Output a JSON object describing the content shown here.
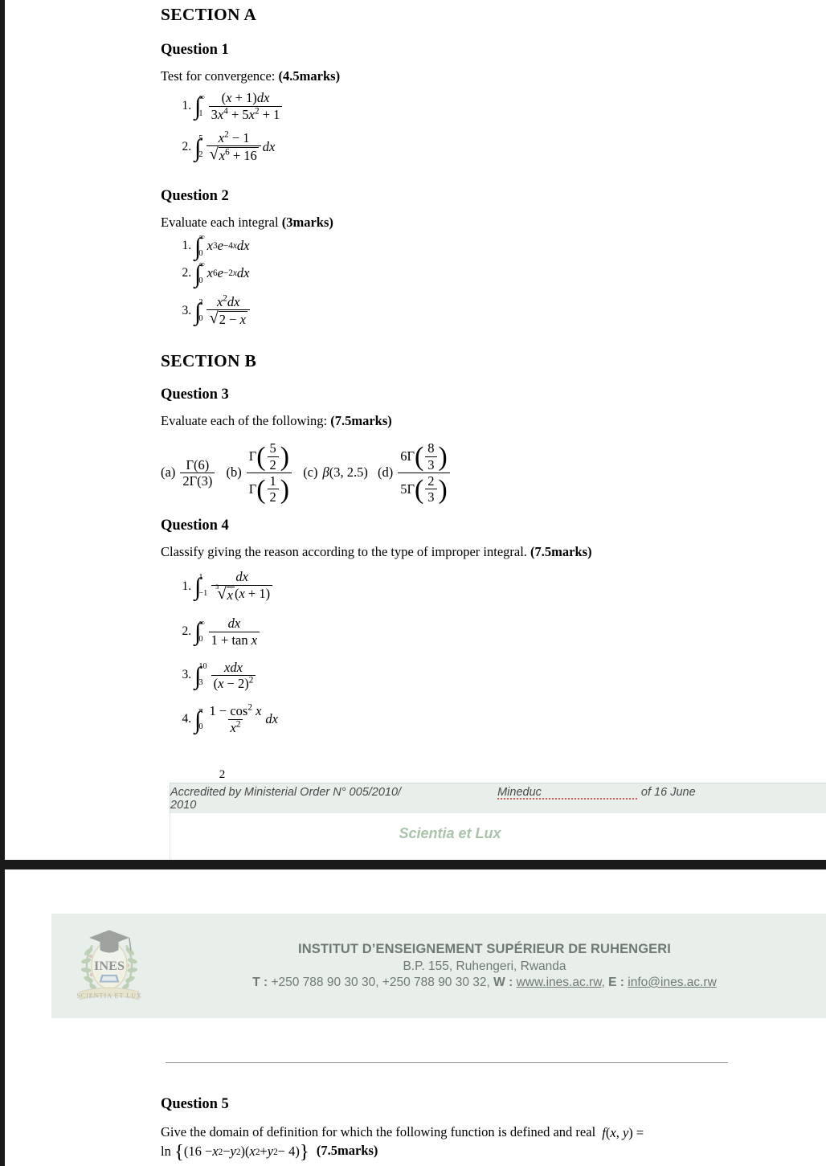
{
  "document": {
    "page_number": "2"
  },
  "page1": {
    "sections": [
      {
        "heading": "SECTION A",
        "questions": [
          {
            "title": "Question 1",
            "prompt": "Test for convergence:",
            "marks": "(4.5marks)",
            "items": [
              "integral from 1 to infinity of (x+1)dx / (3x^4 + 5x^2 + 1)",
              "integral from 2 to 5 of (x^2 - 1) / sqrt(x^6 + 16) dx"
            ]
          },
          {
            "title": "Question 2",
            "prompt": "Evaluate each integral",
            "marks": "(3marks)",
            "items": [
              "integral from 0 to infinity of x^3 e^(-4x) dx",
              "integral from 0 to infinity of x^6 e^(-2x) dx",
              "integral from 0 to 2 of x^2 dx / sqrt(2-x)"
            ]
          }
        ]
      },
      {
        "heading": "SECTION B",
        "questions": [
          {
            "title": "Question 3",
            "prompt": "Evaluate each of the following:",
            "marks": "(7.5marks)",
            "parts": [
              {
                "label": "(a)",
                "expr": "Gamma(6) / 2 Gamma(3)"
              },
              {
                "label": "(b)",
                "expr": "Gamma(5/2) / Gamma(1/2)"
              },
              {
                "label": "(c)",
                "expr": "beta(3, 2.5)"
              },
              {
                "label": "(d)",
                "expr": "6 Gamma(8/3) / 5 Gamma(2/3)"
              }
            ]
          },
          {
            "title": "Question 4",
            "prompt": "Classify giving the reason according to the type of improper integral.",
            "marks": "(7.5marks)",
            "items": [
              "integral from -1 to 1 of dx / (cuberoot(x)(x+1))",
              "integral from 0 to infinity of dx / (1 + tan x)",
              "integral from 3 to 10 of x dx / (x-2)^2",
              "integral from 0 to pi of (1 - cos^2 x) / x^2 dx"
            ]
          }
        ]
      }
    ],
    "footer": {
      "accreditation": "Accredited by Ministerial Order N° 005/2010/Mineduc of 16 June 2010",
      "accreditation_prefix": "Accredited by Ministerial Order N° 005/2010/",
      "accreditation_misspelled": "Mineduc",
      "accreditation_suffix": " of 16 June 2010",
      "motto": "Scientia et Lux"
    }
  },
  "page2": {
    "institution": {
      "name": "INSTITUT D’ENSEIGNEMENT SUPÉRIEUR DE RUHENGERI",
      "address": "B.P. 155, Ruhengeri, Rwanda",
      "phone_label": "T :",
      "phone": "+250 788 90 30 30, +250 788 90 30 32,",
      "web_label": "W :",
      "web": "www.ines.ac.rw",
      "email_label": "E :",
      "email": "info@ines.ac.rw",
      "logo_text": "INES",
      "logo_motto": "SCIENTIA ET LUX"
    },
    "question": {
      "title": "Question 5",
      "prompt_line1": "Give the domain of definition for which the following function is defined and real f(x, y) =",
      "prompt_line2": "ln {(16 - x^2 - y^2)(x^2 + y^2 - 4)}",
      "marks": "(7.5marks)"
    }
  },
  "colors": {
    "band_green": "#e8eeea",
    "motto_green": "#a9c3a9",
    "viewer_dark": "#1a1a1a",
    "text_grey": "#6f7a72"
  }
}
